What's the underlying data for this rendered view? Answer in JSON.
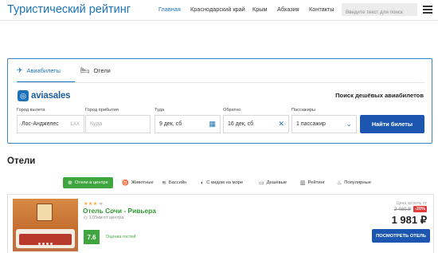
{
  "header": {
    "site_title": "Туристический рейтинг",
    "nav": [
      {
        "label": "Главная",
        "active": true
      },
      {
        "label": "Краснодарский край",
        "active": false
      },
      {
        "label": "Крым",
        "active": false
      },
      {
        "label": "Абхазия",
        "active": false
      },
      {
        "label": "Контакты",
        "active": false
      }
    ],
    "search_placeholder": "Введите текст для поиск"
  },
  "widget": {
    "tabs": [
      {
        "label": "Авиабилеты",
        "icon": "plane-icon",
        "active": true
      },
      {
        "label": "Отели",
        "icon": "bed-icon",
        "active": false
      }
    ],
    "logo_text": "aviasales",
    "title": "Поиск дешёвых авиабилетов",
    "fields": {
      "from": {
        "label": "Город вылета",
        "value": "Лос-Анджелес",
        "code": "LAX"
      },
      "to": {
        "label": "Город прибытия",
        "placeholder": "Куда"
      },
      "depart": {
        "label": "Туда",
        "value": "9 дек, сб"
      },
      "return": {
        "label": "Обратно",
        "value": "16 дек, сб"
      },
      "passengers": {
        "label": "Пассажиры",
        "value": "1 пассажир"
      }
    },
    "find_button": "Найти билеты"
  },
  "hotels": {
    "title": "Отели",
    "filters": [
      {
        "label": "Отели в центре",
        "icon": "target-icon",
        "active": true
      },
      {
        "label": "Животные",
        "icon": "paw-icon",
        "active": false
      },
      {
        "label": "Бассейн",
        "icon": "pool-icon",
        "active": false
      },
      {
        "label": "С видом на море",
        "icon": "sea-view-icon",
        "active": false
      },
      {
        "label": "Дешёвые",
        "icon": "wallet-icon",
        "active": false
      },
      {
        "label": "Рейтинг",
        "icon": "chart-icon",
        "active": false
      },
      {
        "label": "Популярные",
        "icon": "flame-icon",
        "active": false
      }
    ],
    "card": {
      "stars": 3,
      "name": "Отель Сочи - Ривьера",
      "distance": "1.05км от центра",
      "rating": "7.6",
      "rating_label": "Оценка гостей",
      "price_hint": "Цена за ночь от",
      "old_price": "2 480 ₽",
      "discount": "-20%",
      "price": "1 981 ₽",
      "view_button": "ПОСМОТРЕТЬ ОТЕЛЬ"
    }
  },
  "colors": {
    "primary": "#1c73b9",
    "button": "#1c56b0",
    "green": "#3fa63f",
    "discount": "#e63b3b"
  }
}
